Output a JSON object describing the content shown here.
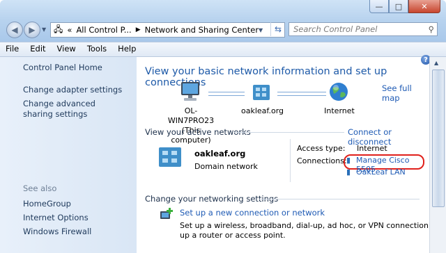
{
  "window": {
    "controls": {
      "minimize": "—",
      "maximize": "□",
      "close": "✕"
    }
  },
  "address": {
    "prefix": "«",
    "crumbs": [
      "All Control P...",
      "Network and Sharing Center"
    ],
    "search_placeholder": "Search Control Panel"
  },
  "menu": [
    "File",
    "Edit",
    "View",
    "Tools",
    "Help"
  ],
  "sidebar": {
    "items": [
      "Control Panel Home",
      "Change adapter settings",
      "Change advanced sharing settings"
    ],
    "see_also_label": "See also",
    "see_also": [
      "HomeGroup",
      "Internet Options",
      "Windows Firewall"
    ]
  },
  "main": {
    "heading": "View your basic network information and set up connections",
    "see_full_map": "See full map",
    "map": {
      "computer_name": "OL-WIN7PRO23",
      "computer_sub": "(This computer)",
      "network": "oakleaf.org",
      "internet": "Internet"
    },
    "active_networks": {
      "title": "View your active networks",
      "connect_link": "Connect or disconnect",
      "network_name": "oakleaf.org",
      "network_type": "Domain network",
      "access_label": "Access type:",
      "access_value": "Internet",
      "connections_label": "Connections:",
      "connections": [
        "Manage Cisco 5505",
        "OakLeaf LAN"
      ]
    },
    "settings": {
      "title": "Change your networking settings",
      "task_link": "Set up a new connection or network",
      "task_desc_1": "Set up a wireless, broadband, dial-up, ad hoc, or VPN connection; or set",
      "task_desc_2": "up a router or access point."
    }
  },
  "colors": {
    "link": "#1e5ab4",
    "heading": "#1e5aa8",
    "highlight": "#e0201b"
  }
}
